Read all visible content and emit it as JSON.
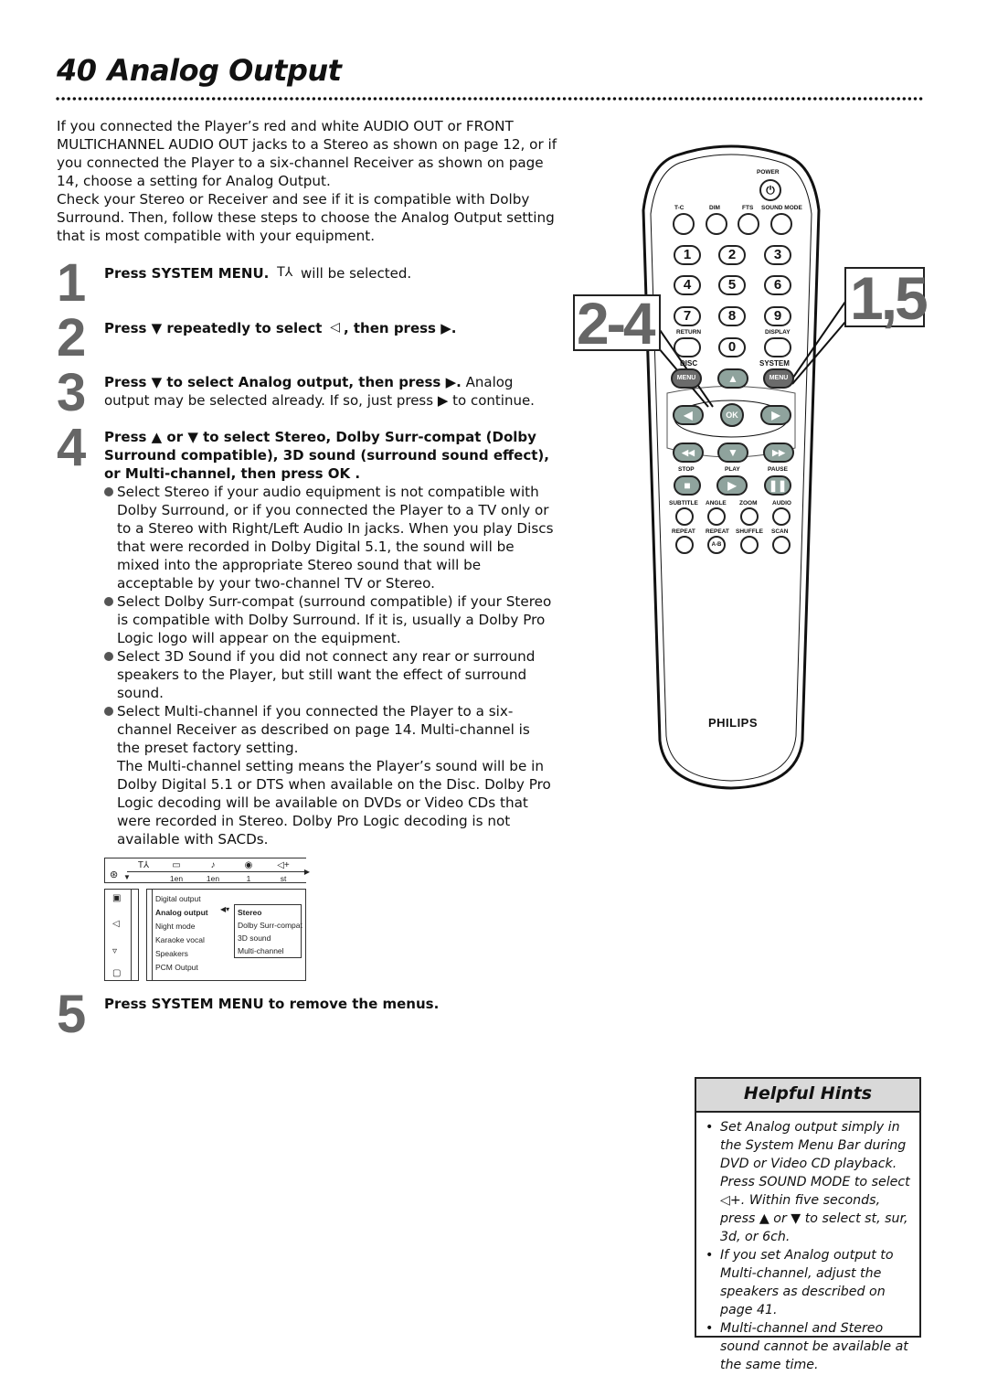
{
  "page": {
    "number": "40",
    "title": "Analog Output"
  },
  "intro": {
    "paragraph1": "If you connected the Player’s red and white AUDIO OUT or FRONT MULTICHANNEL AUDIO OUT jacks to a Stereo as shown on page 12, or if you connected the Player to a six-channel Receiver as shown on page 14, choose a setting for Analog Output.",
    "paragraph2": "Check your Stereo or Receiver and see if it is compatible with Dolby Surround. Then, follow these steps to choose the Analog Output setting that is most compatible with your equipment."
  },
  "steps": [
    {
      "number": "1",
      "bold": "Press SYSTEM MENU.",
      "icon": "system-settings-icon",
      "icon_glyph": "T⅄",
      "rest": "will be selected."
    },
    {
      "number": "2",
      "bold_a": "Press ▼ repeatedly to select",
      "icon": "speaker-icon",
      "icon_glyph": "◁",
      "bold_b": ", then press ▶."
    },
    {
      "number": "3",
      "bold": "Press ▼ to select Analog output, then press ▶.",
      "rest": "Analog output may be selected already. If so, just press ▶ to continue."
    },
    {
      "number": "4",
      "bold": "Press ▲ or ▼ to select Stereo, Dolby Surr-compat (Dolby Surround compatible), 3D sound (surround sound effect), or Multi-channel, then press OK ."
    },
    {
      "number": "5",
      "bold": "Press SYSTEM MENU to remove the menus."
    }
  ],
  "bullets": [
    "Select Stereo if your audio equipment is not compatible with Dolby Surround, or if you connected the Player to a TV only or to a Stereo with Right/Left Audio In jacks. When you play Discs that were recorded in Dolby Digital 5.1, the sound will be mixed into the appropriate Stereo sound that will be acceptable by your two-channel TV or Stereo.",
    "Select Dolby Surr-compat (surround compatible) if your Stereo is compatible with Dolby Surround. If it is, usually a Dolby Pro Logic logo will appear on the equipment.",
    "Select 3D Sound if you did not connect any rear or surround speakers to the Player, but still want the effect of surround sound.",
    "Select Multi-channel if you connected the Player to a six-channel Receiver as described on page 14. Multi-channel is the preset factory setting."
  ],
  "bullet_followup": "The Multi-channel setting means the Player’s sound will be in Dolby Digital 5.1 or DTS when available on the Disc. Dolby Pro Logic decoding will be available on DVDs or Video CDs that were recorded in Stereo. Dolby Pro Logic decoding is not available with SACDs.",
  "menu_screen": {
    "bar_icons": [
      "system-icon",
      "subtitle-icon",
      "audio-language-icon",
      "angle-icon",
      "sound-mode-icon"
    ],
    "bar_glyphs": [
      "T⅄",
      "▭",
      "♪",
      "◉",
      "◁+"
    ],
    "bar_values": [
      "",
      "1en",
      "1en",
      "1",
      "st"
    ],
    "side_icons": [
      "user-icon",
      "speaker-icon",
      "speech-icon",
      "tv-icon"
    ],
    "side_glyphs": [
      "▣",
      "◁",
      "▿",
      "▢"
    ],
    "items": [
      "Digital output",
      "Analog output",
      "Night mode",
      "Karaoke vocal",
      "Speakers",
      "PCM Output"
    ],
    "selected_item": "Analog output",
    "options": [
      "Stereo",
      "Dolby Surr-compat",
      "3D sound",
      "Multi-channel"
    ],
    "selected_option": "Stereo"
  },
  "hints": {
    "title": "Helpful Hints",
    "items": [
      "Set Analog output simply in the System Menu Bar during DVD or Video CD playback. Press SOUND MODE to select ◁+. Within five seconds, press ▲ or ▼ to select st, sur, 3d, or 6ch.",
      "If you set Analog output to Multi-channel, adjust the speakers as described on page 41.",
      "Multi-channel and Stereo sound cannot be available at the same time."
    ]
  },
  "remote": {
    "callouts": [
      "2-4",
      "1,5"
    ],
    "power_label": "POWER",
    "top_labels": [
      "T-C",
      "DIM",
      "FTS",
      "SOUND MODE"
    ],
    "numbers": [
      "1",
      "2",
      "3",
      "4",
      "5",
      "6",
      "7",
      "8",
      "9",
      "0"
    ],
    "return_label": "RETURN",
    "display_label": "DISPLAY",
    "disc_label": "DISC",
    "system_label": "SYSTEM",
    "menu_label": "MENU",
    "ok_label": "OK",
    "transport_labels": [
      "STOP",
      "PLAY",
      "PAUSE"
    ],
    "row1_labels": [
      "SUBTITLE",
      "ANGLE",
      "ZOOM",
      "AUDIO"
    ],
    "row2_labels": [
      "REPEAT",
      "REPEAT",
      "SHUFFLE",
      "SCAN"
    ],
    "ab_label": "A-B",
    "brand": "PHILIPS"
  }
}
